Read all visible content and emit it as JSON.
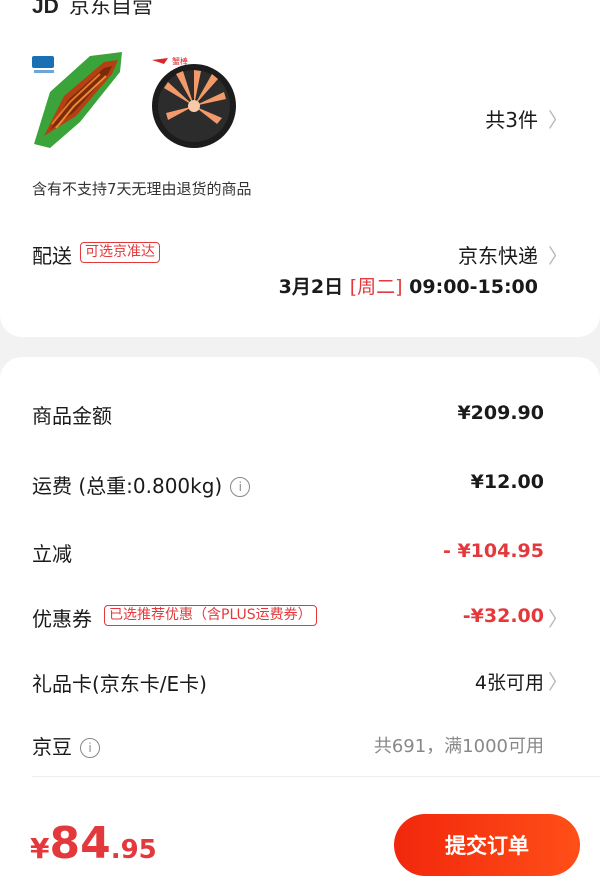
{
  "store": {
    "logo": "JD",
    "name": "京东自营"
  },
  "products": {
    "items": [
      {
        "name": "eel",
        "brand_badge": "鳗鱼"
      },
      {
        "name": "crab-sticks",
        "brand_badge": "蟹棒"
      }
    ],
    "count_label": "共3件",
    "notice": "含有不支持7天无理由退货的商品"
  },
  "delivery": {
    "label": "配送",
    "tag": "可选京准达",
    "method": "京东快递",
    "date": "3月2日",
    "weekday": "[周二]",
    "time_range": "09:00-15:00"
  },
  "summary": {
    "goods_amount": {
      "label": "商品金额",
      "value": "¥209.90"
    },
    "shipping": {
      "label": "运费 (总重:0.800kg)",
      "value": "¥12.00"
    },
    "instant_discount": {
      "label": "立减",
      "value": "- ¥104.95"
    },
    "coupon": {
      "label": "优惠券",
      "tag": "已选推荐优惠（含PLUS运费券）",
      "value": "-¥32.00"
    },
    "gift_card": {
      "label": "礼品卡(京东卡/E卡)",
      "value": "4张可用"
    },
    "jingdou": {
      "label": "京豆",
      "value": "共691，满1000可用"
    }
  },
  "footer": {
    "currency": "¥",
    "total_int": "84",
    "total_dec": ".95",
    "submit_label": "提交订单"
  },
  "colors": {
    "accent": "#e4393c",
    "button_start": "#f2270c",
    "button_end": "#ff4f18"
  }
}
